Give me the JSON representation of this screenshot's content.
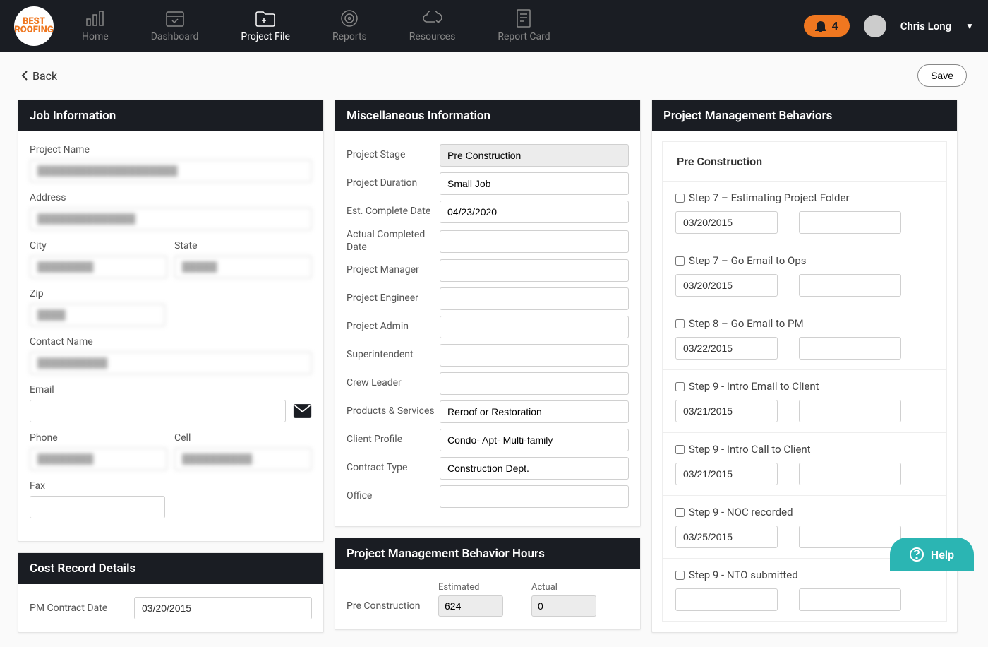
{
  "header": {
    "logo_text": "BEST ROOFING",
    "nav": [
      {
        "label": "Home"
      },
      {
        "label": "Dashboard"
      },
      {
        "label": "Project File"
      },
      {
        "label": "Reports"
      },
      {
        "label": "Resources"
      },
      {
        "label": "Report Card"
      }
    ],
    "notification_count": "4",
    "user_name": "Chris Long"
  },
  "toolbar": {
    "back_label": "Back",
    "save_label": "Save"
  },
  "job_info": {
    "title": "Job Information",
    "labels": {
      "project_name": "Project Name",
      "address": "Address",
      "city": "City",
      "state": "State",
      "zip": "Zip",
      "contact_name": "Contact Name",
      "email": "Email",
      "phone": "Phone",
      "cell": "Cell",
      "fax": "Fax"
    },
    "values": {
      "project_name": "████████████████████",
      "address": "██████████████",
      "city": "████████",
      "state": "█████",
      "zip": "████",
      "contact_name": "██████████",
      "email": "",
      "phone": "████████",
      "cell": "██████████ .",
      "fax": ""
    }
  },
  "misc": {
    "title": "Miscellaneous Information",
    "rows": [
      {
        "label": "Project Stage",
        "value": "Pre Construction",
        "readonly": true
      },
      {
        "label": "Project Duration",
        "value": "Small Job"
      },
      {
        "label": "Est. Complete Date",
        "value": "04/23/2020"
      },
      {
        "label": "Actual Completed Date",
        "value": ""
      },
      {
        "label": "Project Manager",
        "value": ""
      },
      {
        "label": "Project Engineer",
        "value": ""
      },
      {
        "label": "Project Admin",
        "value": ""
      },
      {
        "label": "Superintendent",
        "value": ""
      },
      {
        "label": "Crew Leader",
        "value": ""
      },
      {
        "label": "Products & Services",
        "value": "Reroof or Restoration"
      },
      {
        "label": "Client Profile",
        "value": "Condo- Apt- Multi-family"
      },
      {
        "label": "Contract Type",
        "value": "Construction Dept."
      },
      {
        "label": "Office",
        "value": ""
      }
    ]
  },
  "pmb_hours": {
    "title": "Project Management Behavior Hours",
    "col_estimated": "Estimated",
    "col_actual": "Actual",
    "rows": [
      {
        "label": "Pre Construction",
        "estimated": "624",
        "actual": "0"
      }
    ]
  },
  "cost_record": {
    "title": "Cost Record Details",
    "pm_contract_date_label": "PM Contract Date",
    "pm_contract_date_value": "03/20/2015"
  },
  "behaviors": {
    "title": "Project Management Behaviors",
    "section": "Pre Construction",
    "items": [
      {
        "label": "Step 7 – Estimating Project Folder",
        "date1": "03/20/2015",
        "date2": ""
      },
      {
        "label": "Step 7 – Go Email to Ops",
        "date1": "03/20/2015",
        "date2": ""
      },
      {
        "label": "Step 8 – Go Email to PM",
        "date1": "03/22/2015",
        "date2": ""
      },
      {
        "label": "Step 9 - Intro Email to Client",
        "date1": "03/21/2015",
        "date2": ""
      },
      {
        "label": "Step 9 - Intro Call to Client",
        "date1": "03/21/2015",
        "date2": ""
      },
      {
        "label": "Step 9 - NOC recorded",
        "date1": "03/25/2015",
        "date2": ""
      },
      {
        "label": "Step 9 - NTO submitted",
        "date1": "",
        "date2": ""
      }
    ]
  },
  "help": {
    "label": "Help"
  }
}
